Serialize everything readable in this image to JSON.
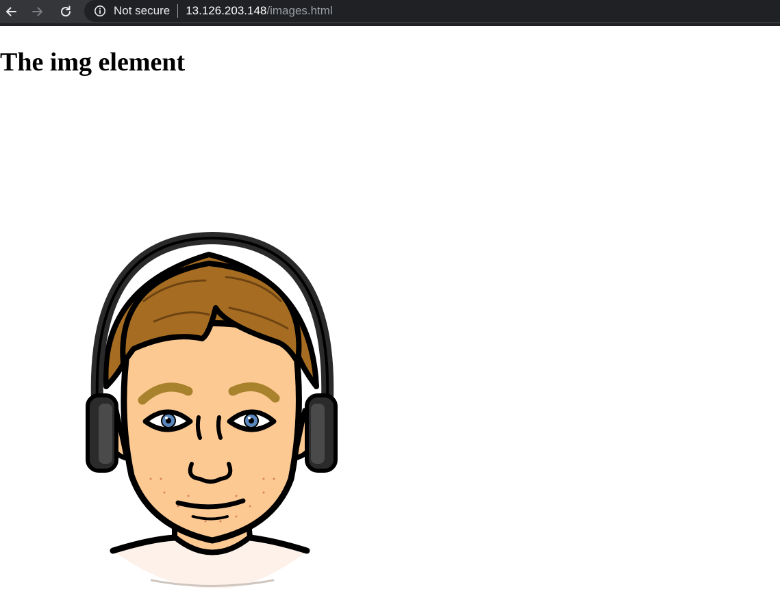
{
  "browser": {
    "security_label": "Not secure",
    "url_host": "13.126.203.148",
    "url_path": "/images.html",
    "icons": {
      "back": "arrow-left-icon",
      "forward": "arrow-right-icon",
      "reload": "reload-icon",
      "info": "info-icon"
    },
    "colors": {
      "toolbar": "#35363a",
      "omnibox": "#202124",
      "text": "#e8eaed",
      "path": "#9aa0a6"
    }
  },
  "page": {
    "heading": "The img element",
    "image": {
      "alt": "",
      "description_icon": "cartoon-avatar-with-headphones"
    }
  }
}
